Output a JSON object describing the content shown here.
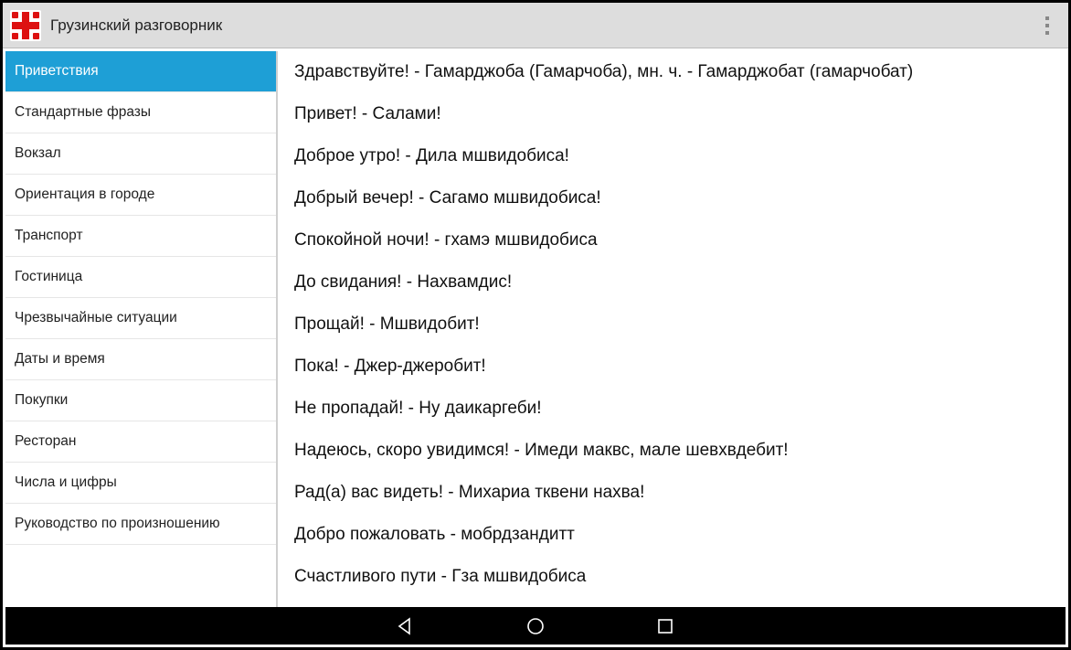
{
  "header": {
    "title": "Грузинский разговорник",
    "icon_name": "georgian-flag-icon",
    "overflow_name": "overflow-menu-icon"
  },
  "sidebar": {
    "selected_index": 0,
    "items": [
      {
        "label": "Приветствия"
      },
      {
        "label": "Стандартные фразы"
      },
      {
        "label": "Вокзал"
      },
      {
        "label": "Ориентация в городе"
      },
      {
        "label": "Транспорт"
      },
      {
        "label": "Гостиница"
      },
      {
        "label": "Чрезвычайные ситуации"
      },
      {
        "label": "Даты и время"
      },
      {
        "label": "Покупки"
      },
      {
        "label": "Ресторан"
      },
      {
        "label": "Числа и цифры"
      },
      {
        "label": "Руководство по произношению"
      }
    ]
  },
  "phrases": [
    {
      "text": "Здравствуйте! - Гамарджоба (Гамарчоба), мн. ч. - Гамарджобат (гамарчобат)"
    },
    {
      "text": "Привет! - Салами!"
    },
    {
      "text": "Доброе утро! - Дила мшвидобиса!"
    },
    {
      "text": "Добрый вечер! - Сагамо мшвидобиса!"
    },
    {
      "text": "Спокойной ночи! - гхамэ мшвидобиса"
    },
    {
      "text": "До свидания! - Нахвамдис!"
    },
    {
      "text": "Прощай! - Мшвидобит!"
    },
    {
      "text": "Пока! - Джер-джеробит!"
    },
    {
      "text": "Не пропадай! - Ну даикаргеби!"
    },
    {
      "text": "Надеюсь, скоро увидимся! - Имеди маквс, мале шевхвдебит!"
    },
    {
      "text": "Рад(а) вас видеть! - Михариа тквени нахва!"
    },
    {
      "text": "Добро пожаловать - мобрдзандитт"
    },
    {
      "text": "Счастливого пути - Гза мшвидобиса"
    }
  ],
  "navbar": {
    "back": "back-button",
    "home": "home-button",
    "recent": "recent-apps-button"
  }
}
